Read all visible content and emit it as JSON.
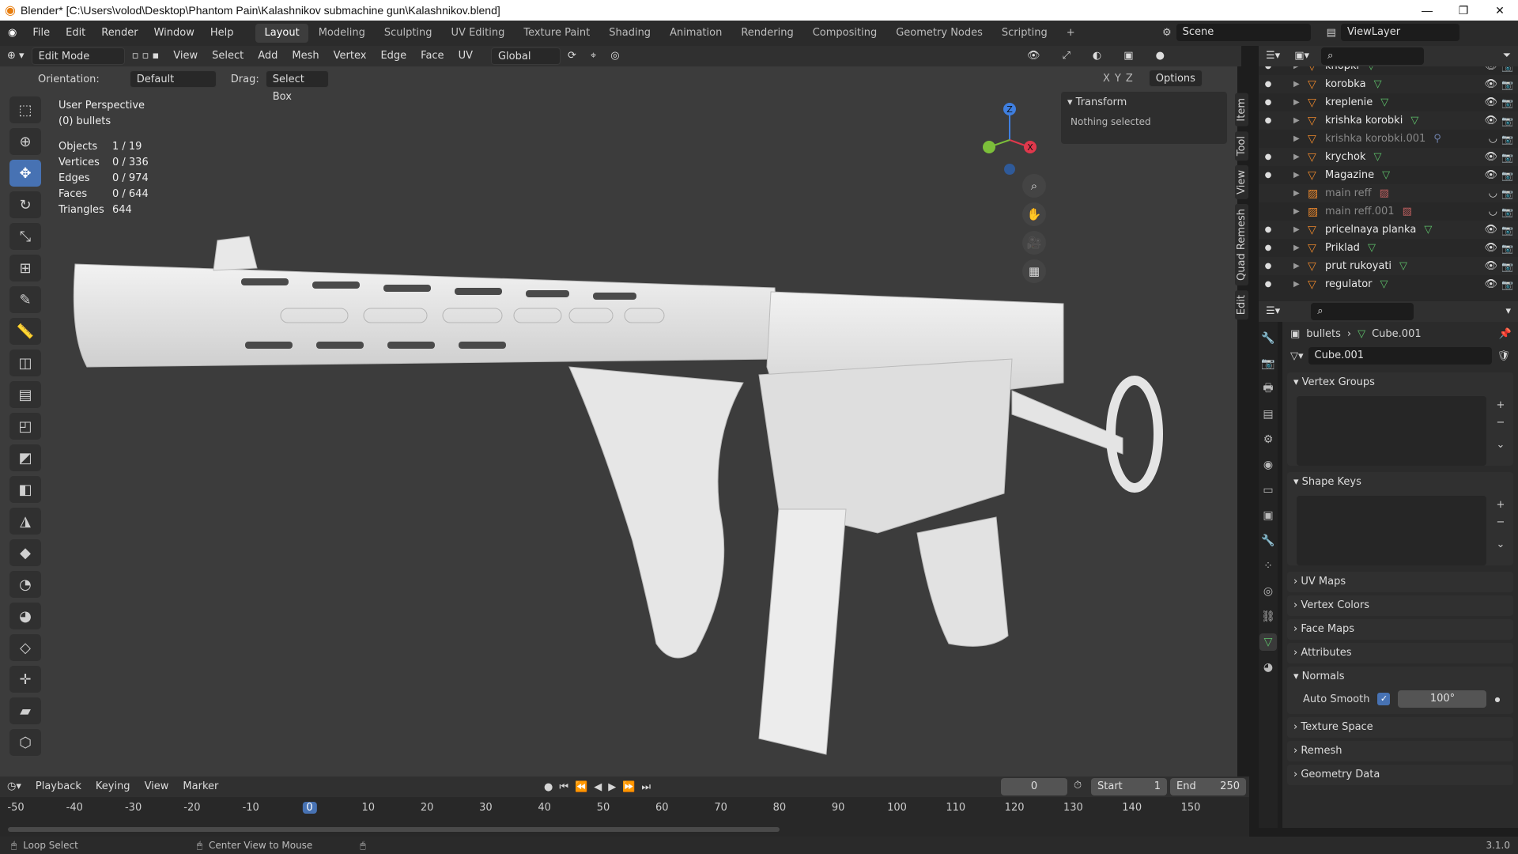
{
  "titlebar": {
    "title": "Blender* [C:\\Users\\volod\\Desktop\\Phantom Pain\\Kalashnikov submachine gun\\Kalashnikov.blend]",
    "minimize": "—",
    "maximize": "❐",
    "close": "✕"
  },
  "menu": [
    "File",
    "Edit",
    "Render",
    "Window",
    "Help"
  ],
  "workspaces": [
    "Layout",
    "Modeling",
    "Sculpting",
    "UV Editing",
    "Texture Paint",
    "Shading",
    "Animation",
    "Rendering",
    "Compositing",
    "Geometry Nodes",
    "Scripting"
  ],
  "active_workspace": "Layout",
  "scene": {
    "label": "Scene",
    "viewlayer": "ViewLayer"
  },
  "header3d": {
    "mode": "Edit Mode",
    "items": [
      "View",
      "Select",
      "Add",
      "Mesh",
      "Vertex",
      "Edge",
      "Face",
      "UV"
    ],
    "transform": "Global",
    "axes": [
      "X",
      "Y",
      "Z"
    ],
    "options": "Options"
  },
  "subheader": {
    "orientation_label": "Orientation:",
    "orientation_value": "Default",
    "drag_label": "Drag:",
    "drag_value": "Select Box"
  },
  "overlay": {
    "perspective": "User Perspective",
    "collection": "(0) bullets"
  },
  "stats": [
    {
      "k": "Objects",
      "v": "1 / 19"
    },
    {
      "k": "Vertices",
      "v": "0 / 336"
    },
    {
      "k": "Edges",
      "v": "0 / 974"
    },
    {
      "k": "Faces",
      "v": "0 / 644"
    },
    {
      "k": "Triangles",
      "v": "644"
    }
  ],
  "npanel": {
    "header": "Transform",
    "text": "Nothing selected",
    "tabs": [
      "Item",
      "Tool",
      "View",
      "Quad Remesh",
      "Edit"
    ]
  },
  "gizmo": {
    "z": "Z",
    "x": "X"
  },
  "outliner": [
    {
      "name": "knopki",
      "dim": false
    },
    {
      "name": "korobka",
      "dim": false
    },
    {
      "name": "kreplenie",
      "dim": false
    },
    {
      "name": "krishka korobki",
      "dim": false
    },
    {
      "name": "krishka korobki.001",
      "dim": true
    },
    {
      "name": "krychok",
      "dim": false
    },
    {
      "name": "Magazine",
      "dim": false
    },
    {
      "name": "main reff",
      "dim": true
    },
    {
      "name": "main reff.001",
      "dim": true
    },
    {
      "name": "pricelnaya planka",
      "dim": false
    },
    {
      "name": "Priklad",
      "dim": false
    },
    {
      "name": "prut rukoyati",
      "dim": false
    },
    {
      "name": "regulator",
      "dim": false
    }
  ],
  "properties": {
    "breadcrumb_obj": "bullets",
    "breadcrumb_mesh": "Cube.001",
    "mesh_name": "Cube.001",
    "panels": [
      "Vertex Groups",
      "Shape Keys",
      "UV Maps",
      "Vertex Colors",
      "Face Maps",
      "Attributes",
      "Normals",
      "Texture Space",
      "Remesh",
      "Geometry Data"
    ],
    "auto_smooth_label": "Auto Smooth",
    "auto_smooth_angle": "100°"
  },
  "timeline": {
    "menus": [
      "Playback",
      "Keying",
      "View",
      "Marker"
    ],
    "current_frame": "0",
    "start_label": "Start",
    "start": "1",
    "end_label": "End",
    "end": "250",
    "ticks": [
      "-50",
      "-40",
      "-30",
      "-20",
      "-10",
      "0",
      "10",
      "20",
      "30",
      "40",
      "50",
      "60",
      "70",
      "80",
      "90",
      "100",
      "110",
      "120",
      "130",
      "140",
      "150"
    ]
  },
  "statusbar": {
    "left": "Loop Select",
    "mid": "Center View to Mouse",
    "version": "3.1.0"
  }
}
